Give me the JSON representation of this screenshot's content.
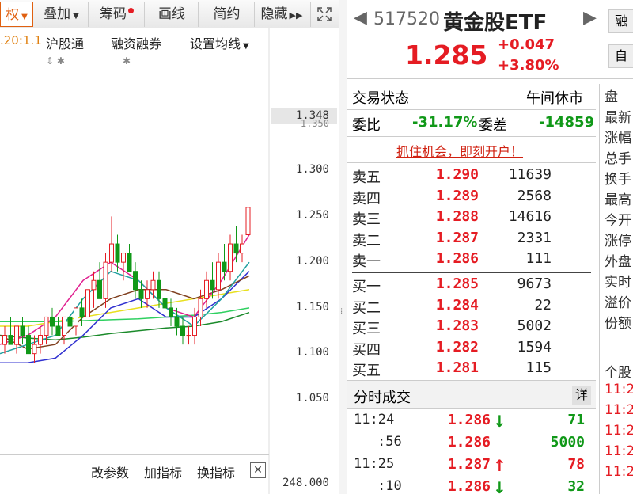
{
  "toolbar": {
    "items": [
      {
        "label": "权",
        "active": true
      },
      {
        "label": "叠加"
      },
      {
        "label": "筹码"
      },
      {
        "label": "画线"
      },
      {
        "label": "简约"
      },
      {
        "label": "隐藏"
      }
    ],
    "more_icon": "double-right-arrow-icon",
    "fullscreen_icon": "expand-icon"
  },
  "chart": {
    "ma_label": ".20:1.1",
    "links": [
      "沪股通",
      "融资融券",
      "设置均线"
    ],
    "price_marker": "1.348",
    "y_ticks": [
      "1.350",
      "1.300",
      "1.250",
      "1.200",
      "1.150",
      "1.100",
      "1.050"
    ],
    "volume_tick": "248.000",
    "bottom_buttons": [
      "改参数",
      "加指标",
      "换指标"
    ],
    "close_icon": "close-icon"
  },
  "quote": {
    "code": "517520",
    "name": "黄金股ETF",
    "price": "1.285",
    "change": "+0.047",
    "change_pct": "+3.80%",
    "side_btn_1": "融",
    "side_btn_2": "自"
  },
  "status": {
    "label": "交易状态",
    "value": "午间休市",
    "ratio_label": "委比",
    "ratio_value": "-31.17%",
    "diff_label": "委差",
    "diff_value": "-14859",
    "promo": "抓住机会，即刻开户！"
  },
  "asks": [
    {
      "label": "卖五",
      "price": "1.290",
      "vol": "11639"
    },
    {
      "label": "卖四",
      "price": "1.289",
      "vol": "2568"
    },
    {
      "label": "卖三",
      "price": "1.288",
      "vol": "14616"
    },
    {
      "label": "卖二",
      "price": "1.287",
      "vol": "2331"
    },
    {
      "label": "卖一",
      "price": "1.286",
      "vol": "111"
    }
  ],
  "bids": [
    {
      "label": "买一",
      "price": "1.285",
      "vol": "9673"
    },
    {
      "label": "买二",
      "price": "1.284",
      "vol": "22"
    },
    {
      "label": "买三",
      "price": "1.283",
      "vol": "5002"
    },
    {
      "label": "买四",
      "price": "1.282",
      "vol": "1594"
    },
    {
      "label": "买五",
      "price": "1.281",
      "vol": "115"
    }
  ],
  "trades": {
    "title": "分时成交",
    "detail_btn": "详",
    "rows": [
      {
        "time": "11:24",
        "price": "1.286",
        "dir": "down",
        "vol": "71"
      },
      {
        "time": ":56",
        "price": "1.286",
        "dir": "",
        "vol": "5000"
      },
      {
        "time": "11:25",
        "price": "1.287",
        "dir": "up",
        "vol": "78"
      },
      {
        "time": ":10",
        "price": "1.286",
        "dir": "down",
        "vol": "32"
      }
    ]
  },
  "side_fields": [
    "盘",
    "最新",
    "涨幅",
    "总手",
    "换手",
    "最高",
    "今开",
    "涨停",
    "外盘",
    "实时",
    "溢价",
    "份额",
    "个股",
    "11:2",
    "11:2",
    "11:2",
    "11:2",
    "11:2"
  ],
  "colors": {
    "up": "#e51c23",
    "down": "#109818",
    "accent": "#e06010"
  }
}
